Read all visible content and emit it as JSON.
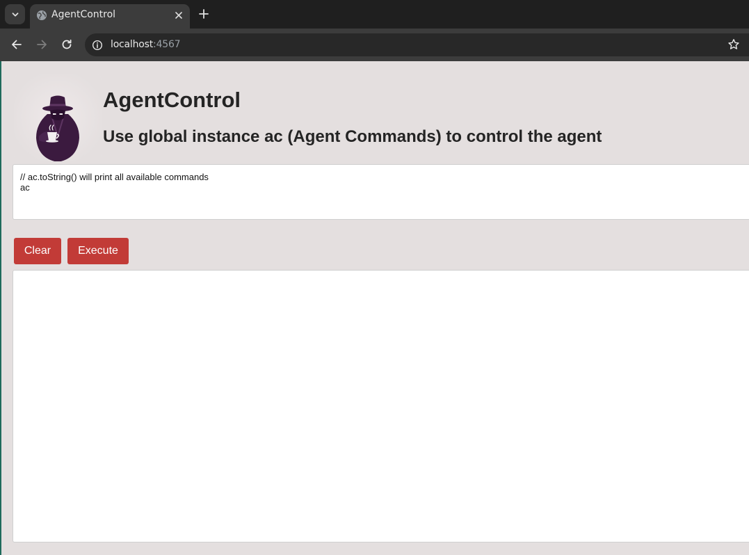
{
  "browser": {
    "tab": {
      "title": "AgentControl"
    },
    "address_bar": {
      "host": "localhost",
      "port": ":4567"
    }
  },
  "app": {
    "title": "AgentControl",
    "subtitle": "Use global instance ac (Agent Commands) to control the agent",
    "editor": {
      "lines": [
        "// ac.toString() will print all available commands",
        "ac"
      ]
    },
    "buttons": {
      "clear": "Clear",
      "execute": "Execute"
    },
    "output": ""
  },
  "icons": {
    "tab_dropdown": "chevron-down-icon",
    "favicon": "globe-icon",
    "tab_close": "close-icon",
    "new_tab": "plus-icon",
    "back": "arrow-left-icon",
    "forward": "arrow-right-icon",
    "reload": "reload-icon",
    "site_info": "info-icon",
    "bookmark": "star-icon",
    "logo": "spy-detective-coffee-logo"
  },
  "colors": {
    "page_background": "#e4dfdf",
    "button_background": "#c23b37",
    "button_text": "#ffffff",
    "heading_text": "#242424",
    "logo_purple": "#3b1a3f"
  }
}
